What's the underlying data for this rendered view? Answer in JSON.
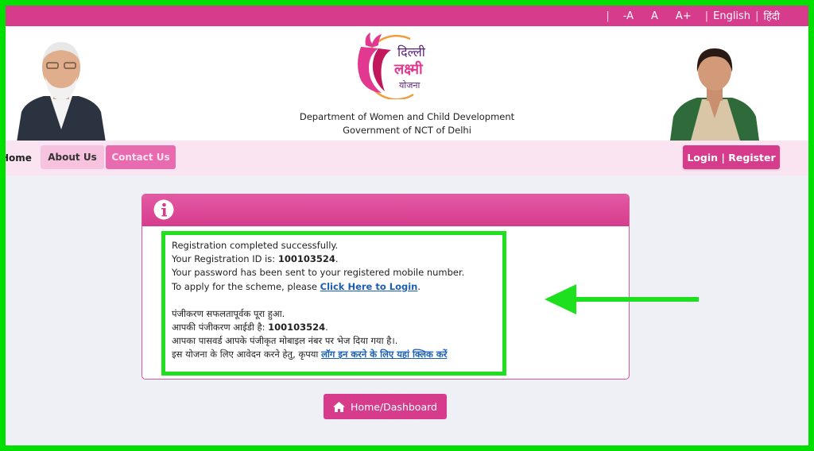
{
  "topbar": {
    "font_decrease": "-A",
    "font_normal": "A",
    "font_increase": "A+",
    "lang_english": "English",
    "lang_hindi": "हिंदी"
  },
  "header": {
    "logo_icon": "lotus-woman-logo",
    "logo_text_1": "दिल्ली",
    "logo_text_2": "लक्ष्मी",
    "logo_text_3": "योजना",
    "department": "Department of Women and Child Development",
    "government": "Government of NCT of Delhi"
  },
  "nav": {
    "home": "Home",
    "about": "About Us",
    "contact": "Contact Us",
    "login": "Login | Register"
  },
  "message": {
    "header_icon": "info-icon",
    "line1": "Registration completed successfully.",
    "line2_prefix": "Your Registration ID is: ",
    "registration_id": "100103524",
    "line2_suffix": ".",
    "line3": "Your password has been sent to your registered mobile number.",
    "line4_prefix": "To apply for the scheme, please ",
    "login_link": "Click Here to Login",
    "line4_suffix": ".",
    "hi_line1": "पंजीकरण सफलतापूर्वक पूरा हुआ.",
    "hi_line2_prefix": "आपकी पंजीकरण आईडी है: ",
    "hi_registration_id": "100103524",
    "hi_line2_suffix": ".",
    "hi_line3": "आपका पासवर्ड आपके पंजीकृत मोबाइल नंबर पर भेज दिया गया है।.",
    "hi_line4_prefix": "इस योजना के लिए आवेदन करने हेतु, कृपया ",
    "hi_login_link": "लॉग इन करने के लिए यहां क्लिक करें"
  },
  "dashboard_button": {
    "icon": "home-icon",
    "label": "Home/Dashboard"
  },
  "colors": {
    "brand_pink": "#d63b8c",
    "nav_bg": "#fbe4f1",
    "highlight_green": "#1fe01f",
    "link_blue": "#1a5fb4"
  }
}
